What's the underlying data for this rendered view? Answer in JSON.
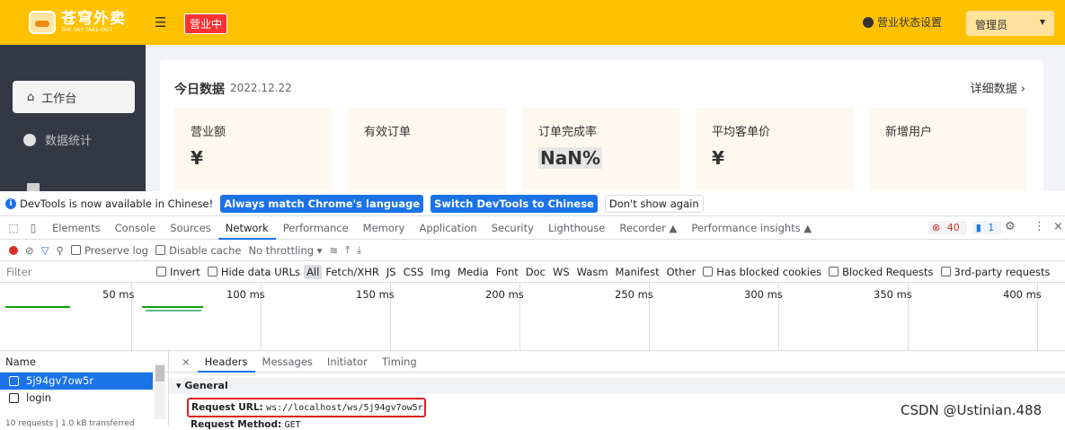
{
  "app": {
    "logo_cn": "苍穹外卖",
    "logo_en": "THE SKY TAKE-OUT",
    "status_badge": "营业中",
    "status_setting": "营业状态设置",
    "admin_label": "管理员",
    "sidebar": [
      {
        "label": "工作台",
        "icon": "home-icon",
        "active": true
      },
      {
        "label": "数据统计",
        "icon": "chart-icon",
        "active": false
      }
    ],
    "card": {
      "title": "今日数据",
      "date": "2022.12.22",
      "detail_link": "详细数据 ›",
      "tiles": [
        {
          "label": "营业额",
          "value": "¥"
        },
        {
          "label": "有效订单",
          "value": ""
        },
        {
          "label": "订单完成率",
          "value": "NaN%"
        },
        {
          "label": "平均客单价",
          "value": "¥"
        },
        {
          "label": "新增用户",
          "value": ""
        }
      ]
    }
  },
  "devtools": {
    "banner": {
      "text": "DevTools is now available in Chinese!",
      "btn_match": "Always match Chrome's language",
      "btn_switch": "Switch DevTools to Chinese",
      "btn_dismiss": "Don't show again"
    },
    "tabs": [
      "Elements",
      "Console",
      "Sources",
      "Network",
      "Performance",
      "Memory",
      "Application",
      "Security",
      "Lighthouse",
      "Recorder ▲",
      "Performance insights ▲"
    ],
    "active_tab": "Network",
    "error_count": "40",
    "message_count": "1",
    "toolbar": {
      "preserve_log": "Preserve log",
      "disable_cache": "Disable cache",
      "throttling": "No throttling"
    },
    "filter": {
      "placeholder": "Filter",
      "invert": "Invert",
      "hide_data_urls": "Hide data URLs",
      "types": [
        "All",
        "Fetch/XHR",
        "JS",
        "CSS",
        "Img",
        "Media",
        "Font",
        "Doc",
        "WS",
        "Wasm",
        "Manifest",
        "Other"
      ],
      "has_blocked_cookies": "Has blocked cookies",
      "blocked_requests": "Blocked Requests",
      "third_party": "3rd-party requests"
    },
    "timeline_ticks": [
      "50 ms",
      "100 ms",
      "150 ms",
      "200 ms",
      "250 ms",
      "300 ms",
      "350 ms",
      "400 ms"
    ],
    "name_header": "Name",
    "requests": [
      {
        "name": "5j94gv7ow5r",
        "selected": true
      },
      {
        "name": "login",
        "selected": false
      }
    ],
    "footer": "10 requests | 1.0 kB transferred",
    "detail_tabs": [
      "Headers",
      "Messages",
      "Initiator",
      "Timing"
    ],
    "active_detail_tab": "Headers",
    "general_label": "▾ General",
    "request_url_label": "Request URL:",
    "request_url": "ws://localhost/ws/5j94gv7ow5r",
    "request_method_label": "Request Method:",
    "request_method": "GET"
  },
  "watermark": "CSDN @Ustinian.488"
}
